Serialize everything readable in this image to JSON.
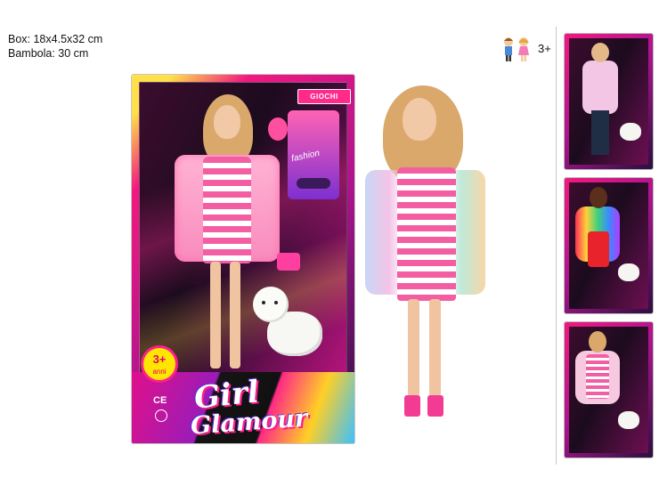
{
  "specs": {
    "box": "Box: 18x4.5x32 cm",
    "doll": "Bambola: 30 cm"
  },
  "package": {
    "brand_tag": "GIOCHI",
    "age_badge": "3+",
    "age_badge_sub": "anni",
    "ce_mark": "CE",
    "accessory_text": "fashion",
    "logo_line1": "Girl",
    "logo_line2": "Glamour"
  },
  "age_indicator": {
    "icon": "kids-icon",
    "label": "3+"
  },
  "variants": [
    "variant-fluffy-white-coat",
    "variant-rainbow-coat",
    "variant-striped-dress"
  ],
  "colors": {
    "pink": "#f35ea3",
    "magenta": "#e0108a",
    "yellow": "#ffe600",
    "dark": "#1c0b1e"
  }
}
